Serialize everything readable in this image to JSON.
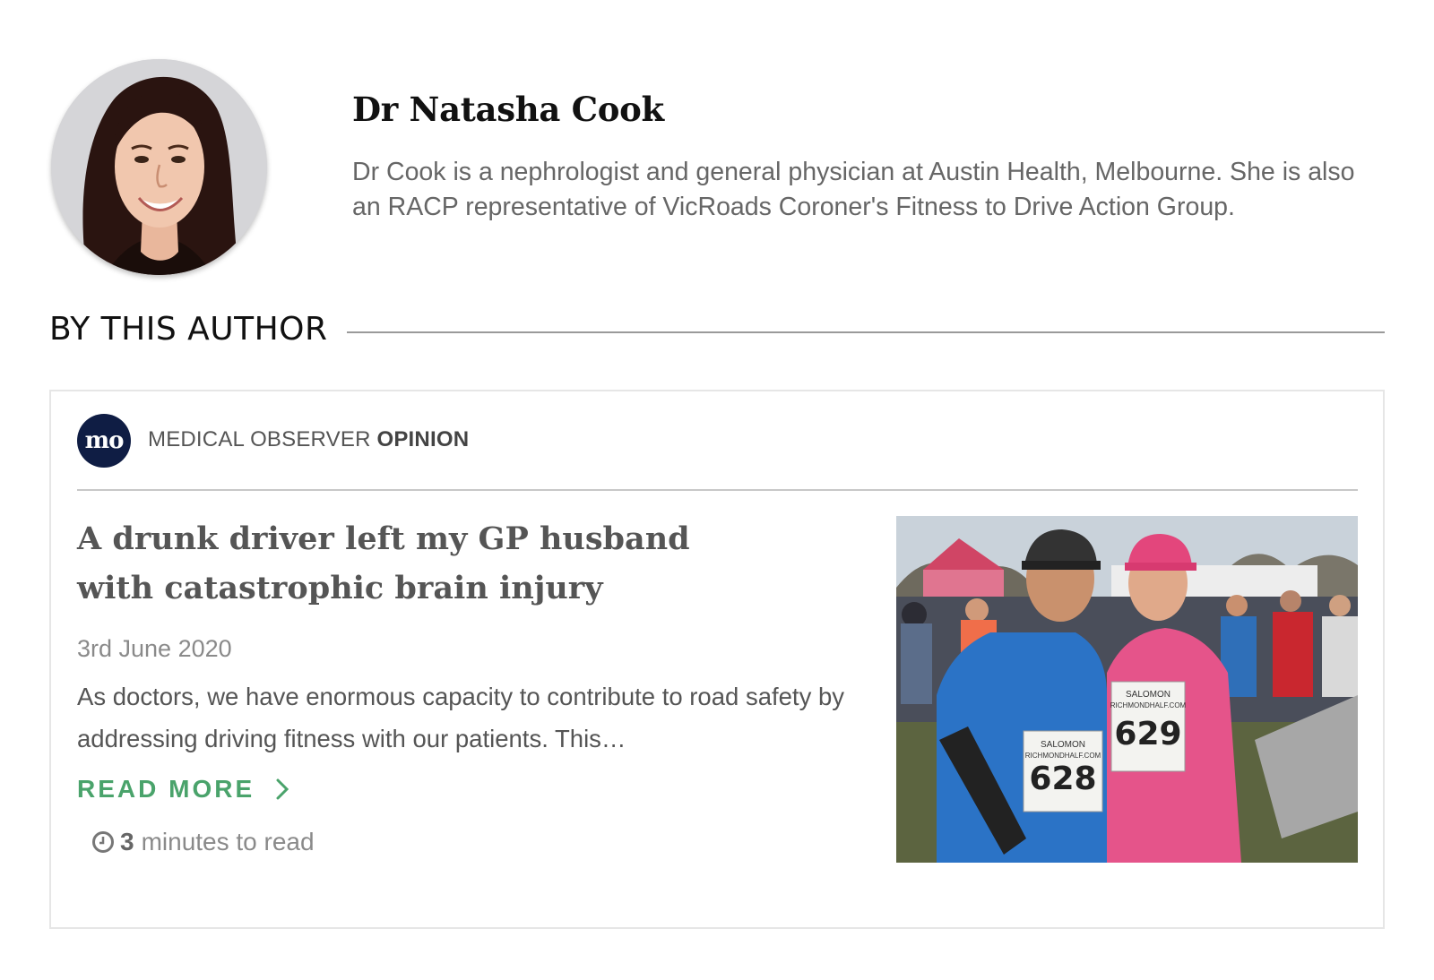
{
  "author": {
    "name": "Dr Natasha Cook",
    "bio": "Dr Cook is a nephrologist and general physician at Austin Health, Melbourne. She is also an RACP representative of VicRoads Coroner's Fitness to Drive Action Group.",
    "avatar_icon": "author-portrait"
  },
  "section": {
    "title": "BY THIS AUTHOR"
  },
  "card": {
    "brand_logo": "mo",
    "brand_name": "MEDICAL OBSERVER",
    "brand_category": "OPINION",
    "title": "A drunk driver left my GP husband with catastrophic brain injury",
    "date": "3rd June 2020",
    "excerpt": "As doctors, we have enormous capacity to contribute to road safety by addressing driving fitness with our patients.  This…",
    "read_more": "READ MORE",
    "read_time_value": "3",
    "read_time_text": "minutes to read",
    "photo_bibs": [
      "628",
      "629"
    ],
    "photo_bib_brand": "SALOMON",
    "photo_bib_site": "RICHMONDHALF.COM"
  },
  "colors": {
    "accent_green": "#4aa36b",
    "brand_navy": "#0f1d44",
    "text_grey": "#555555"
  }
}
